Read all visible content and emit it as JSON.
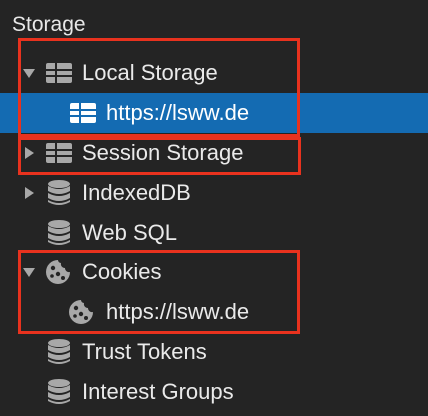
{
  "section": {
    "title": "Storage"
  },
  "tree": {
    "local_storage": {
      "label": "Local Storage",
      "expanded": true,
      "icon": "table-grid-icon"
    },
    "local_storage_origin": {
      "label": "https://lsww.de",
      "selected": true,
      "icon": "table-grid-icon"
    },
    "session_storage": {
      "label": "Session Storage",
      "expanded": false,
      "icon": "table-grid-icon"
    },
    "indexeddb": {
      "label": "IndexedDB",
      "expanded": false,
      "icon": "database-icon"
    },
    "web_sql": {
      "label": "Web SQL",
      "icon": "database-icon"
    },
    "cookies": {
      "label": "Cookies",
      "expanded": true,
      "icon": "cookie-icon"
    },
    "cookies_origin": {
      "label": "https://lsww.de",
      "icon": "cookie-icon"
    },
    "trust_tokens": {
      "label": "Trust Tokens",
      "icon": "database-icon"
    },
    "interest_groups": {
      "label": "Interest Groups",
      "icon": "database-icon"
    }
  },
  "colors": {
    "background": "#242424",
    "selection": "#146bb2",
    "highlight_box": "#e8321e",
    "icon_gray": "#a8a8a8"
  }
}
